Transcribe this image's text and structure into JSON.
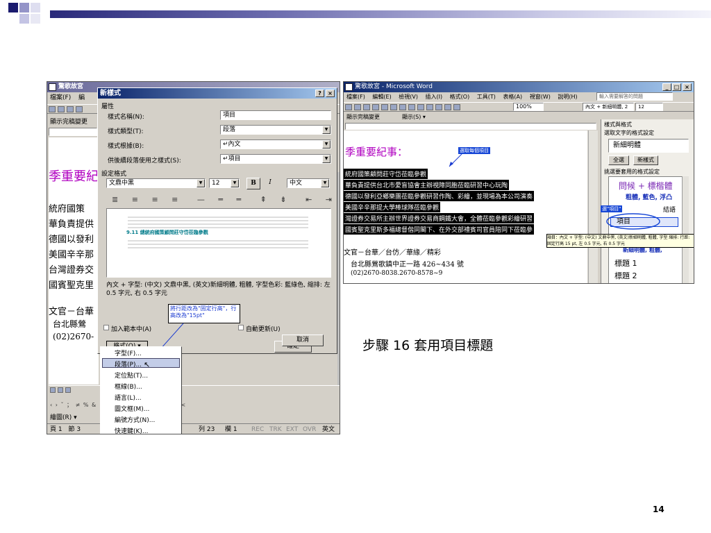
{
  "slide": {
    "caption": "步驟 16  套用項目標題",
    "page_number": "14"
  },
  "left_shot": {
    "word_window": {
      "title": "驚歌故宮",
      "menu": [
        "檔案(F)",
        "編"
      ],
      "status_left": "顯示完稿變更",
      "doc_lines": [
        "季重要紀",
        "統府國策",
        "華負責提供",
        "德國以發利",
        "美國辛辛那",
        "台灣證券交",
        "國賓聖克里",
        "文官－台華",
        "台北縣鶯",
        "(02)2670-"
      ],
      "bottom_toolbar": "繪圖(R) ▾",
      "status_bar": [
        "頁 1",
        "節 3",
        "列 23",
        "欄 1",
        "REC",
        "TRK",
        "EXT",
        "OVR",
        "英文"
      ],
      "symbol_row": "‹ › ˇ ； ≠ % & ＊ ※ ○ ◎ □ ⊕ ＋ － × ÷ <"
    },
    "dialog": {
      "title": "新樣式",
      "help_button": "?",
      "close_button": "×",
      "properties_group": "屬性",
      "name_label": "樣式名稱(N):",
      "name_value": "項目",
      "type_label": "樣式類型(T):",
      "type_value": "段落",
      "based_on_label": "樣式根據(B):",
      "based_on_value": "↵內文",
      "following_label": "供後續段落使用之樣式(S):",
      "following_value": "↵項目",
      "format_group": "設定格式",
      "font_value": "文鼎中黑",
      "size_value": "12",
      "bold_label": "B",
      "italic_label": "I",
      "lang_value": "中文",
      "preview_sample": "9.11 總統府國策顧問莊守岱莅臨參觀",
      "description": "內文 + 字型: (中文) 文鼎中黑, (英文)新細明體, 粗體, 字型色彩: 藍綠色, 縮排: 左 0.5 字元, 右 0.5 字元",
      "add_template_label": "加入範本中(A)",
      "auto_update_label": "自動更新(U)",
      "format_button": "格式(O) ▾",
      "ok_button": "確定",
      "cancel_button": "取消",
      "callout": "將行距改為\"固定行高\"，行高改為\"15pt\""
    },
    "format_menu": [
      "字型(F)...",
      "段落(P)...",
      "定位點(T)...",
      "框線(B)...",
      "語言(L)...",
      "圖文框(M)...",
      "編號方式(N)...",
      "快速鍵(K)..."
    ],
    "format_menu_selected": 1
  },
  "right_shot": {
    "title": "驚歌故宮 - Microsoft Word",
    "menu": [
      "檔案(F)",
      "編輯(E)",
      "檢視(V)",
      "插入(I)",
      "格式(O)",
      "工具(T)",
      "表格(A)",
      "視窗(W)",
      "說明(H)"
    ],
    "help_box": "輸入需要解答的問題",
    "zoom": "100%",
    "toolbar_style": "內文 + 新細明體, 2",
    "toolbar_size": "12",
    "status_left": "顯示完稿變更",
    "display_label": "顯示(S) ▾",
    "doc_heading": "季重要紀事：",
    "callout_select": "選取每個項目",
    "doc_lines": [
      "統府國策顧問莊守岱莅臨參觀",
      "華負責提供台北市愛盲協會主辦視障同胞莅臨研習中心玩陶",
      "德國以發利亞鄉樂團莅臨參觀研習作陶、彩繪，並現場為本公司演奏",
      "美國辛辛那提大學棒球隊莅臨參觀",
      "灣證券交易所主辦世界證券交易商鋼鐵大會，全體莅臨參觀彩繪研習",
      "國賓聖克里斯多福總督偕同閣下、在外交部禮賓司官員陪同下莅臨參"
    ],
    "doc_footer": [
      "文官－台華／台仿／華緣／精彩",
      "台北縣鶯歌鎮中正一路 426~434 號",
      "(02)2670-8038.2670-8578~9"
    ],
    "pane": {
      "title": "樣式與格式",
      "select_label": "選取文字的格式設定",
      "current_format": "新細明體",
      "select_all": "全選",
      "new_style": "新樣式",
      "apply_label": "挑選要套用的格式設定",
      "items": [
        "問候 + 標楷體",
        "粗體, 藍色, 浮凸",
        "結語",
        "項目",
        "新細明體, 粗體,",
        "標題 1",
        "標題 2"
      ],
      "selected_item": "項目",
      "select_tag": "選\"項目\"",
      "tooltip": "項目：內文 + 字型: (中文) 文鼎中黑, (英文)新細明體, 粗體, 字型 縮排: 行距: 固定行高 15 pt, 左 0.5 字元, 右 0.5 字元"
    }
  }
}
